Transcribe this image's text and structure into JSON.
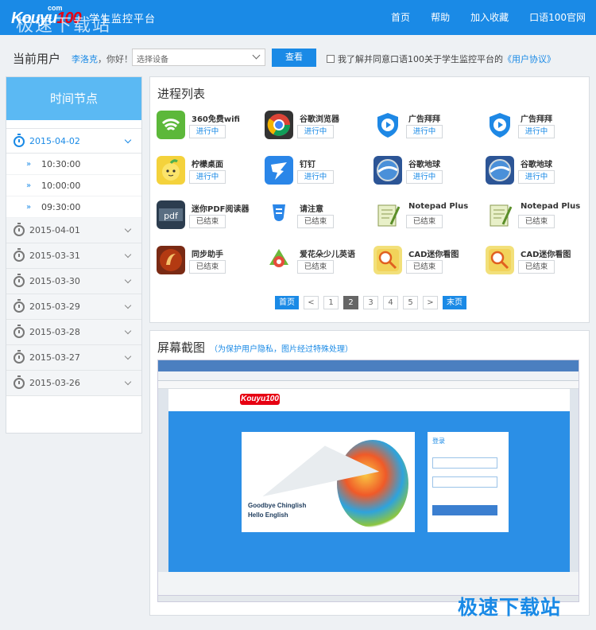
{
  "header": {
    "brand": "Kouyu",
    "brand_num": "100",
    "brand_com": "com",
    "site_name": "学生监控平台",
    "watermark": "极速下载站",
    "nav": [
      "首页",
      "帮助",
      "加入收藏",
      "口语100官网"
    ]
  },
  "userbar": {
    "label": "当前用户",
    "user_name": "李洛克",
    "greeting": "，你好！",
    "select_placeholder": "选择设备",
    "view_button": "查看",
    "agree_text": "我了解并同意口语100关于学生监控平台的",
    "agree_link": "《用户协议》"
  },
  "sidebar": {
    "title": "时间节点",
    "active_date": "2015-04-02",
    "times": [
      "10:30:00",
      "10:00:00",
      "09:30:00"
    ],
    "dates": [
      "2015-04-01",
      "2015-03-31",
      "2015-03-30",
      "2015-03-29",
      "2015-03-28",
      "2015-03-27",
      "2015-03-26"
    ]
  },
  "process": {
    "title": "进程列表",
    "apps": [
      {
        "name": "360免费wifi",
        "status": "进行中",
        "icon": "wifi-icon"
      },
      {
        "name": "谷歌浏览器",
        "status": "进行中",
        "icon": "chrome-icon"
      },
      {
        "name": "广告拜拜",
        "status": "进行中",
        "icon": "shield-play-icon"
      },
      {
        "name": "广告拜拜",
        "status": "进行中",
        "icon": "shield-play-icon"
      },
      {
        "name": "柠檬桌面",
        "status": "进行中",
        "icon": "lemon-icon"
      },
      {
        "name": "钉钉",
        "status": "进行中",
        "icon": "dingtalk-icon"
      },
      {
        "name": "谷歌地球",
        "status": "进行中",
        "icon": "google-earth-icon"
      },
      {
        "name": "谷歌地球",
        "status": "进行中",
        "icon": "google-earth-icon"
      },
      {
        "name": "迷你PDF阅读器",
        "status": "已结束",
        "icon": "pdf-icon"
      },
      {
        "name": "请注意",
        "status": "已结束",
        "icon": "favicon-icon"
      },
      {
        "name": "Notepad Plus",
        "status": "已结束",
        "icon": "notepad-icon"
      },
      {
        "name": "Notepad Plus",
        "status": "已结束",
        "icon": "notepad-icon"
      },
      {
        "name": "同步助手",
        "status": "已结束",
        "icon": "sync-icon"
      },
      {
        "name": "爱花朵少儿英语",
        "status": "已结束",
        "icon": "flower-icon"
      },
      {
        "name": "CAD迷你看图",
        "status": "已结束",
        "icon": "cad-icon"
      },
      {
        "name": "CAD迷你看图",
        "status": "已结束",
        "icon": "cad-icon"
      }
    ],
    "pager": {
      "first": "首页",
      "prev": "<",
      "pages": [
        "1",
        "2",
        "3",
        "4",
        "5"
      ],
      "current": "2",
      "next": ">",
      "last": "末页"
    }
  },
  "screenshot": {
    "title": "屏幕截图",
    "subtitle": "（为保护用户隐私，图片经过特殊处理）",
    "inner_logo": "Kouyu100",
    "inner_text1": "Goodbye  Chinglish",
    "inner_text2": "Hello  English",
    "inner_login_title": "登录"
  },
  "corner_watermark": "极速下载站",
  "colors": {
    "primary": "#1a8ae6",
    "sidebar_head": "#5bb9f3"
  }
}
